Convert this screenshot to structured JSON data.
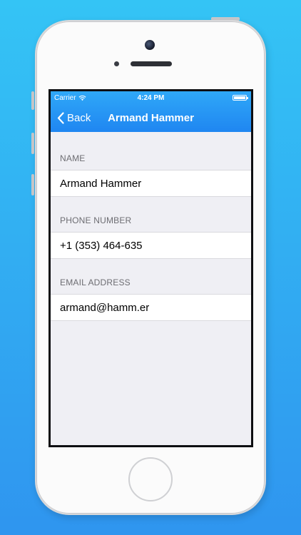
{
  "status_bar": {
    "carrier": "Carrier",
    "time": "4:24 PM"
  },
  "nav_bar": {
    "back_label": "Back",
    "title": "Armand Hammer"
  },
  "sections": [
    {
      "header": "NAME",
      "value": "Armand Hammer"
    },
    {
      "header": "PHONE NUMBER",
      "value": "+1 (353) 464-635"
    },
    {
      "header": "EMAIL ADDRESS",
      "value": "armand@hamm.er"
    }
  ],
  "colors": {
    "background_top": "#34c4f5",
    "background_bottom": "#2f95ef",
    "nav_bar": "#1f86f1",
    "table_background": "#efeff4",
    "section_header_text": "#6d6d72"
  },
  "icons": [
    "wifi-icon",
    "battery-icon",
    "back-chevron-icon"
  ]
}
